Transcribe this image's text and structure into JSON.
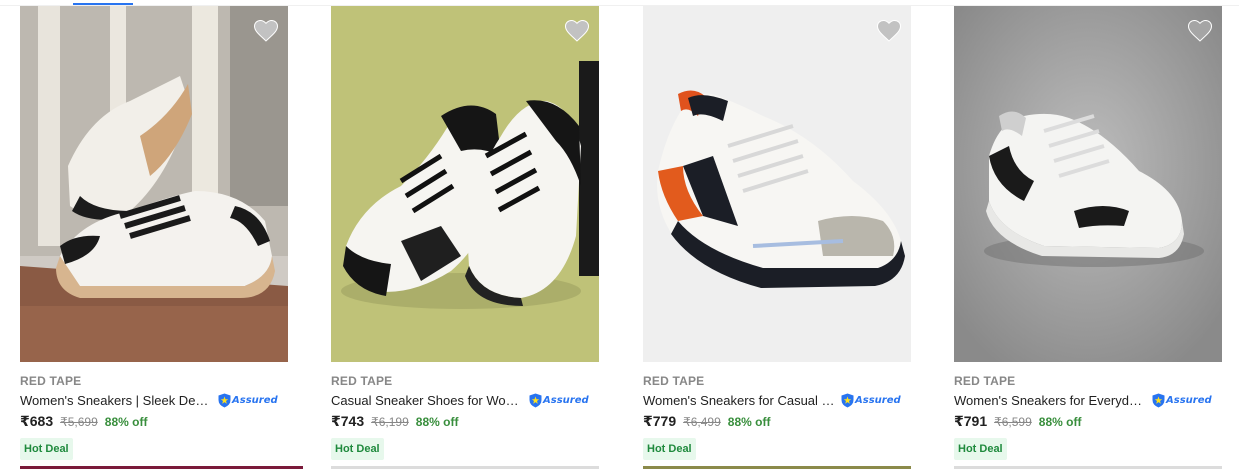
{
  "products": [
    {
      "brand": "RED TAPE",
      "title": "Women's Sneakers | Sleek Desi...",
      "assured_label": "Assured",
      "price": "₹683",
      "mrp": "₹5,699",
      "discount": "88% off",
      "badge": "Hot Deal",
      "wishlist_icon": "heart-icon",
      "bottom_color": "#7a1a3a"
    },
    {
      "brand": "RED TAPE",
      "title": "Casual Sneaker Shoes for Wome...",
      "assured_label": "Assured",
      "price": "₹743",
      "mrp": "₹6,199",
      "discount": "88% off",
      "badge": "Hot Deal",
      "wishlist_icon": "heart-icon",
      "bottom_color": "#dcdcdc"
    },
    {
      "brand": "RED TAPE",
      "title": "Women's Sneakers for Casual E...",
      "assured_label": "Assured",
      "price": "₹779",
      "mrp": "₹6,499",
      "discount": "88% off",
      "badge": "Hot Deal",
      "wishlist_icon": "heart-icon",
      "bottom_color": "#8b8a4a"
    },
    {
      "brand": "RED TAPE",
      "title": "Women's Sneakers for Everyday ...",
      "assured_label": "Assured",
      "price": "₹791",
      "mrp": "₹6,599",
      "discount": "88% off",
      "badge": "Hot Deal",
      "wishlist_icon": "heart-icon",
      "bottom_color": "#dcdcdc"
    }
  ],
  "colors": {
    "accent": "#2874f0",
    "discount_green": "#388e3c",
    "deal_bg": "#e7f8ec"
  }
}
